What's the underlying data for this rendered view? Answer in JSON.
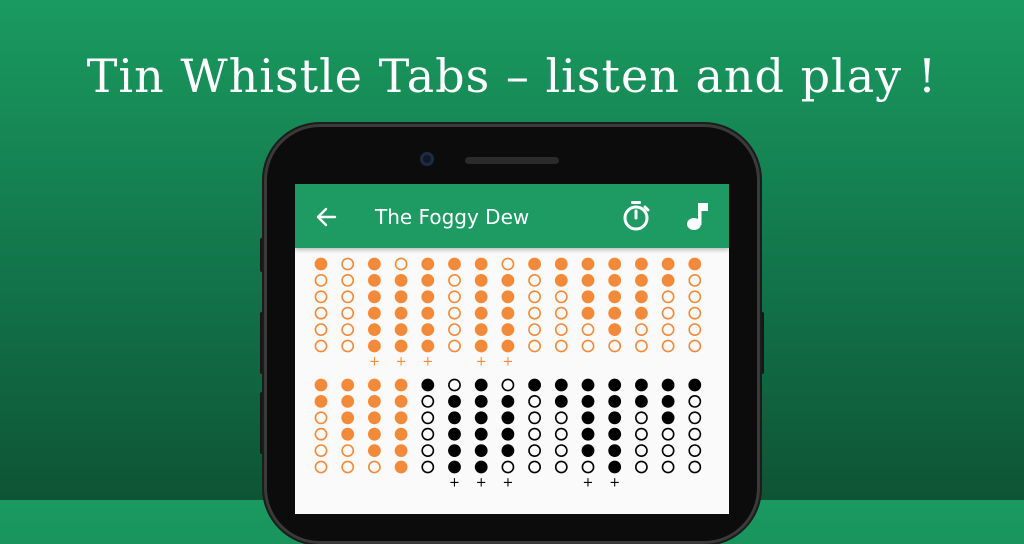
{
  "banner": {
    "headline": "Tin Whistle Tabs – listen and play !"
  },
  "appbar": {
    "title": "The Foggy Dew"
  },
  "icons": {
    "back": "arrow-left-icon",
    "timer": "stopwatch-icon",
    "music": "music-note-icon"
  },
  "colors": {
    "background": "#168a57",
    "appbar": "#1e9a63",
    "note_orange": "#f28a3a",
    "note_black": "#000000",
    "screen": "#fafafa"
  },
  "tabs": {
    "rows": [
      [
        {
          "holes": [
            1,
            0,
            0,
            0,
            0,
            0
          ],
          "plus": false,
          "color": "orange"
        },
        {
          "holes": [
            0,
            0,
            0,
            0,
            0,
            0
          ],
          "plus": false,
          "color": "orange"
        },
        {
          "holes": [
            1,
            1,
            1,
            1,
            1,
            1
          ],
          "plus": true,
          "color": "orange"
        },
        {
          "holes": [
            0,
            1,
            1,
            1,
            1,
            1
          ],
          "plus": true,
          "color": "orange"
        },
        {
          "holes": [
            1,
            1,
            1,
            1,
            1,
            1
          ],
          "plus": true,
          "color": "orange"
        },
        {
          "holes": [
            1,
            0,
            0,
            0,
            0,
            0
          ],
          "plus": false,
          "color": "orange"
        },
        {
          "holes": [
            1,
            1,
            1,
            1,
            1,
            1
          ],
          "plus": true,
          "color": "orange"
        },
        {
          "holes": [
            0,
            1,
            1,
            1,
            1,
            1
          ],
          "plus": true,
          "color": "orange"
        },
        {
          "holes": [
            1,
            0,
            0,
            0,
            0,
            0
          ],
          "plus": false,
          "color": "orange"
        },
        {
          "holes": [
            1,
            1,
            0,
            0,
            0,
            0
          ],
          "plus": false,
          "color": "orange"
        },
        {
          "holes": [
            1,
            1,
            1,
            1,
            0,
            0
          ],
          "plus": false,
          "color": "orange"
        },
        {
          "holes": [
            1,
            1,
            1,
            1,
            1,
            0
          ],
          "plus": false,
          "color": "orange"
        },
        {
          "holes": [
            1,
            1,
            1,
            1,
            0,
            0
          ],
          "plus": false,
          "color": "orange"
        },
        {
          "holes": [
            1,
            1,
            0,
            0,
            0,
            0
          ],
          "plus": false,
          "color": "orange"
        },
        {
          "holes": [
            1,
            0,
            0,
            0,
            0,
            0
          ],
          "plus": false,
          "color": "orange"
        }
      ],
      [
        {
          "holes": [
            1,
            1,
            0,
            0,
            0,
            0
          ],
          "plus": false,
          "color": "orange"
        },
        {
          "holes": [
            1,
            1,
            1,
            1,
            0,
            0
          ],
          "plus": false,
          "color": "orange"
        },
        {
          "holes": [
            1,
            1,
            1,
            1,
            1,
            0
          ],
          "plus": false,
          "color": "orange"
        },
        {
          "holes": [
            1,
            1,
            1,
            1,
            1,
            1
          ],
          "plus": false,
          "color": "orange"
        },
        {
          "holes": [
            1,
            0,
            0,
            0,
            0,
            0
          ],
          "plus": false,
          "color": "black"
        },
        {
          "holes": [
            0,
            1,
            1,
            1,
            1,
            1
          ],
          "plus": true,
          "color": "black"
        },
        {
          "holes": [
            1,
            1,
            1,
            1,
            1,
            1
          ],
          "plus": true,
          "color": "black"
        },
        {
          "holes": [
            0,
            1,
            1,
            1,
            1,
            0
          ],
          "plus": true,
          "color": "black"
        },
        {
          "holes": [
            1,
            0,
            0,
            0,
            0,
            0
          ],
          "plus": false,
          "color": "black"
        },
        {
          "holes": [
            1,
            1,
            0,
            0,
            0,
            0
          ],
          "plus": false,
          "color": "black"
        },
        {
          "holes": [
            1,
            1,
            1,
            1,
            1,
            0
          ],
          "plus": true,
          "color": "black"
        },
        {
          "holes": [
            1,
            1,
            1,
            1,
            1,
            1
          ],
          "plus": true,
          "color": "black"
        },
        {
          "holes": [
            1,
            1,
            0,
            0,
            0,
            0
          ],
          "plus": false,
          "color": "black"
        },
        {
          "holes": [
            1,
            1,
            1,
            0,
            0,
            0
          ],
          "plus": false,
          "color": "black"
        },
        {
          "holes": [
            1,
            0,
            0,
            0,
            0,
            0
          ],
          "plus": false,
          "color": "black"
        }
      ]
    ]
  }
}
